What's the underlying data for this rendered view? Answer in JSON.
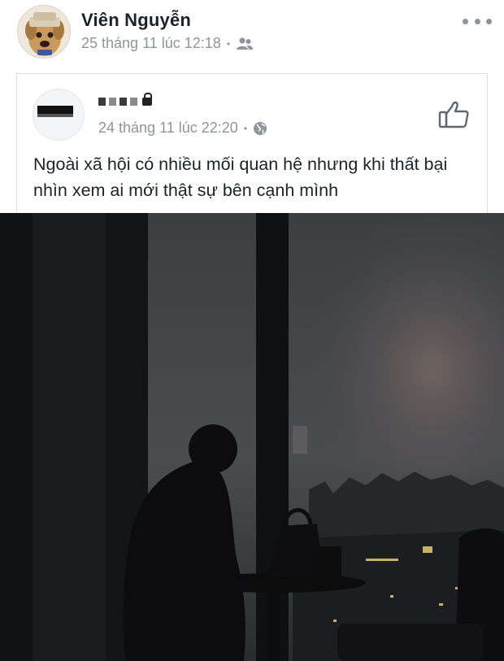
{
  "post": {
    "author_name": "Viên Nguyễn",
    "timestamp": "25 tháng 11 lúc 12:18",
    "audience_icon": "friends-icon",
    "more_icon": "more-options-icon"
  },
  "shared_post": {
    "author_name": "",
    "timestamp": "24 tháng 11 lúc 22:20",
    "audience_icon": "globe-icon",
    "like_icon": "thumbs-up-icon",
    "text": "Ngoài xã hội có nhiều mối quan hệ nhưng khi thất bại nhìn xem ai mới thật sự bên cạnh mình"
  },
  "photo": {
    "subject": "silhouette-at-window-night-city"
  },
  "colors": {
    "text_primary": "#1d2129",
    "text_secondary": "#90949c",
    "border": "#dddfe2"
  }
}
